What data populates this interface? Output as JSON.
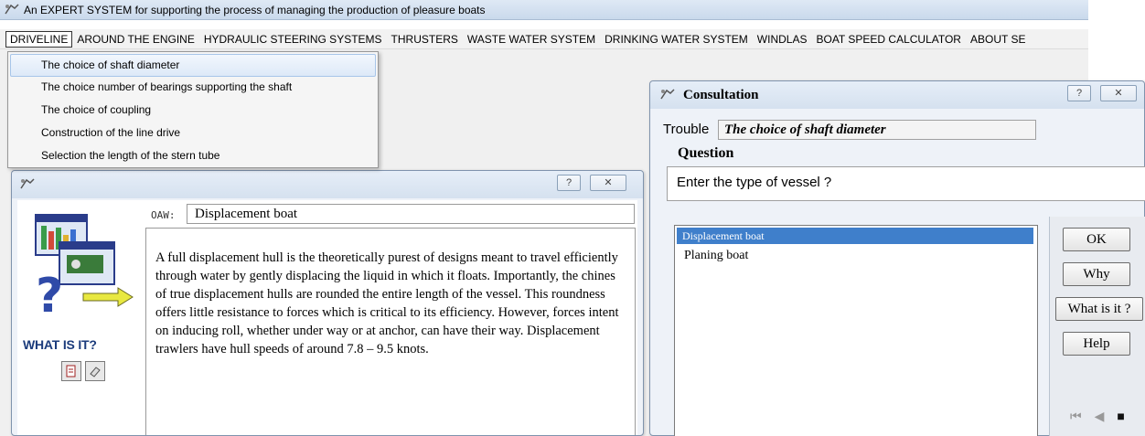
{
  "app": {
    "title": "An EXPERT SYSTEM for supporting the process of managing the production of pleasure boats",
    "menu": [
      "DRIVELINE",
      "AROUND THE ENGINE",
      "HYDRAULIC STEERING SYSTEMS",
      "THRUSTERS",
      "WASTE WATER SYSTEM",
      "DRINKING WATER SYSTEM",
      "WINDLAS",
      "BOAT SPEED CALCULATOR",
      "ABOUT SE"
    ]
  },
  "dropdown": {
    "items": [
      "The choice of shaft diameter",
      "The choice number of bearings supporting the shaft",
      "The choice of coupling",
      "Construction of the line drive",
      "Selection the length of the stern tube"
    ]
  },
  "whatis_dialog": {
    "help_button": "?",
    "close_button": "✕",
    "oaw_label": "OAW:",
    "oaw_value": "Displacement boat",
    "description": "A full displacement hull is the theoretically purest of designs meant to travel efficiently through water by gently displacing the liquid in which it floats. Importantly, the chines of true displacement hulls are rounded the entire length of the vessel. This roundness offers little resistance to forces which is critical to its efficiency. However, forces intent on inducing roll, whether under way or at anchor, can have their way. Displacement trawlers have hull speeds of around 7.8 – 9.5 knots.",
    "whatis_label": "WHAT IS IT?"
  },
  "consult_dialog": {
    "title": "Consultation",
    "help_button": "?",
    "close_button": "✕",
    "trouble_label": "Trouble",
    "trouble_value": "The choice of shaft diameter",
    "question_label": "Question",
    "question_text": "Enter the type of vessel ?",
    "answers": [
      "Displacement boat",
      "Planing boat"
    ],
    "buttons": {
      "ok": "OK",
      "why": "Why",
      "what": "What is it ?",
      "help": "Help"
    },
    "nav": {
      "first": "⏮",
      "prev": "◀",
      "stop": "■"
    }
  }
}
